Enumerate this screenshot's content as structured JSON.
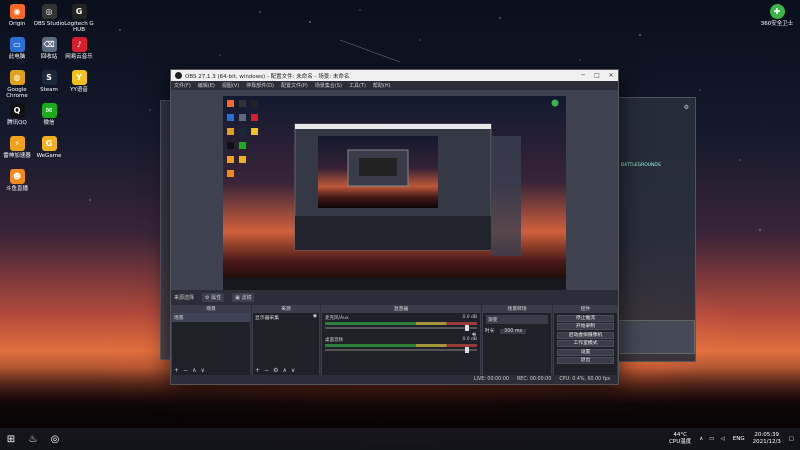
{
  "desktop": {
    "icons_left": [
      {
        "label": "Origin",
        "color": "#f5682a",
        "glyph": "◉"
      },
      {
        "label": "OBS Studio",
        "color": "#333333",
        "glyph": "◎"
      },
      {
        "label": "Logitech G HUB",
        "color": "#222222",
        "glyph": "G"
      },
      {
        "label": "此电脑",
        "color": "#2a6fd6",
        "glyph": "▭"
      },
      {
        "label": "回收站",
        "color": "#5a6b80",
        "glyph": "⌫"
      },
      {
        "label": "网易云音乐",
        "color": "#d81e2d",
        "glyph": "♪"
      },
      {
        "label": "Google Chrome",
        "color": "#e0a21c",
        "glyph": "◍"
      },
      {
        "label": "Steam",
        "color": "#1b2838",
        "glyph": "S"
      },
      {
        "label": "YY语音",
        "color": "#f1c21b",
        "glyph": "Y"
      },
      {
        "label": "腾讯QQ",
        "color": "#111111",
        "glyph": "Q"
      },
      {
        "label": "微信",
        "color": "#1aad19",
        "glyph": "✉"
      },
      {
        "label": "雷神加速器",
        "color": "#f0a21c",
        "glyph": "⚡"
      },
      {
        "label": "WeGame",
        "color": "#f0b020",
        "glyph": "G"
      },
      {
        "label": "斗鱼直播",
        "color": "#f08a20",
        "glyph": "☻"
      }
    ],
    "icon_right": {
      "label": "360安全卫士",
      "color": "#3ab54a",
      "glyph": "✚"
    }
  },
  "obs": {
    "title": "OBS 27.1.3 (64-bit, windows) - 配置文件: 未命名 - 场景: 未命名",
    "menu": [
      "文件(F)",
      "编辑(E)",
      "视图(V)",
      "停靠部件(D)",
      "配置文件(P)",
      "场景集合(S)",
      "工具(T)",
      "帮助(H)"
    ],
    "scene_bar_label": "来源选择",
    "scene_bar_buttons": [
      "属性",
      "滤镜"
    ],
    "docks": {
      "scenes": {
        "title": "场景",
        "items": [
          "场景"
        ]
      },
      "sources": {
        "title": "来源",
        "items": [
          "显示器采集"
        ]
      },
      "mixer": {
        "title": "混音器",
        "tracks": [
          {
            "name": "麦克风/Aux",
            "db": "0.0 dB"
          },
          {
            "name": "桌面音频",
            "db": "0.0 dB"
          }
        ]
      },
      "transitions": {
        "title": "场景转场",
        "type": "渐变",
        "duration_label": "时长",
        "duration": "300 ms"
      },
      "controls": {
        "title": "控件",
        "buttons": [
          "停止推流",
          "开始录制",
          "启动虚拟摄像机",
          "工作室模式",
          "设置",
          "退出"
        ]
      }
    },
    "status": {
      "live": "LIVE: 00:00:00",
      "rec": "REC: 00:00:00",
      "cpu": "CPU: 0.4%, 60.00 fps"
    }
  },
  "taskbar": {
    "weather": {
      "temp": "44°C",
      "label": "CPU温度"
    },
    "lang": "ENG",
    "time": "20:05:39",
    "date": "2021/12/3"
  }
}
